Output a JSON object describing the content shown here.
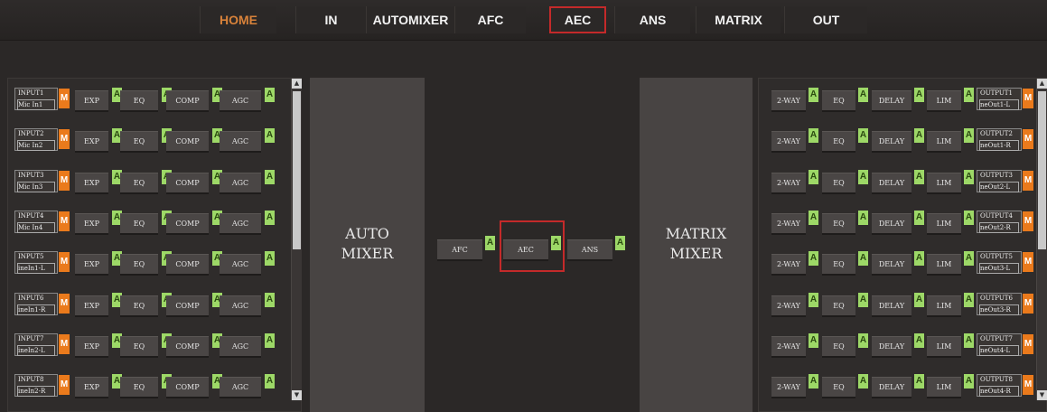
{
  "nav": {
    "tabs": [
      {
        "label": "HOME",
        "active": true
      },
      {
        "label": "IN"
      },
      {
        "label": "AUTOMIXER"
      },
      {
        "label": "AFC"
      },
      {
        "label": "AEC",
        "selected": true
      },
      {
        "label": "ANS"
      },
      {
        "label": "MATRIX"
      },
      {
        "label": "OUT"
      }
    ]
  },
  "inputs": {
    "rows": [
      {
        "id": "INPUT1",
        "name": "Mic In1",
        "mute": "M"
      },
      {
        "id": "INPUT2",
        "name": "Mic In2",
        "mute": "M"
      },
      {
        "id": "INPUT3",
        "name": "Mic In3",
        "mute": "M"
      },
      {
        "id": "INPUT4",
        "name": "Mic In4",
        "mute": "M"
      },
      {
        "id": "INPUT5",
        "name": "ineIn1-L",
        "mute": "M"
      },
      {
        "id": "INPUT6",
        "name": "ineIn1-R",
        "mute": "M"
      },
      {
        "id": "INPUT7",
        "name": "ineIn2-L",
        "mute": "M"
      },
      {
        "id": "INPUT8",
        "name": "ineIn2-R",
        "mute": "M"
      }
    ],
    "modules": [
      "EXP",
      "EQ",
      "COMP",
      "AGC"
    ],
    "active_label": "A"
  },
  "automixer": {
    "line1": "AUTO",
    "line2": "MIXER"
  },
  "chain": {
    "modules": [
      {
        "label": "AFC",
        "active": "A"
      },
      {
        "label": "AEC",
        "active": "A"
      },
      {
        "label": "ANS",
        "active": "A"
      }
    ]
  },
  "matrix": {
    "line1": "MATRIX",
    "line2": "MIXER"
  },
  "outputs": {
    "rows": [
      {
        "id": "OUTPUT1",
        "name": "neOut1-L",
        "mute": "M"
      },
      {
        "id": "OUTPUT2",
        "name": "neOut1-R",
        "mute": "M"
      },
      {
        "id": "OUTPUT3",
        "name": "neOut2-L",
        "mute": "M"
      },
      {
        "id": "OUTPUT4",
        "name": "neOut2-R",
        "mute": "M"
      },
      {
        "id": "OUTPUT5",
        "name": "neOut3-L",
        "mute": "M"
      },
      {
        "id": "OUTPUT6",
        "name": "neOut3-R",
        "mute": "M"
      },
      {
        "id": "OUTPUT7",
        "name": "neOut4-L",
        "mute": "M"
      },
      {
        "id": "OUTPUT8",
        "name": "neOut4-R",
        "mute": "M"
      }
    ],
    "modules": [
      "2-WAY",
      "EQ",
      "DELAY",
      "LIM"
    ],
    "active_label": "A"
  },
  "scroll": {
    "up": "▲",
    "down": "▼"
  },
  "colors": {
    "accent_orange": "#ea7a1c",
    "active_green": "#9dd867",
    "highlight_red": "#c42a2a",
    "home_text": "#d8823a"
  }
}
